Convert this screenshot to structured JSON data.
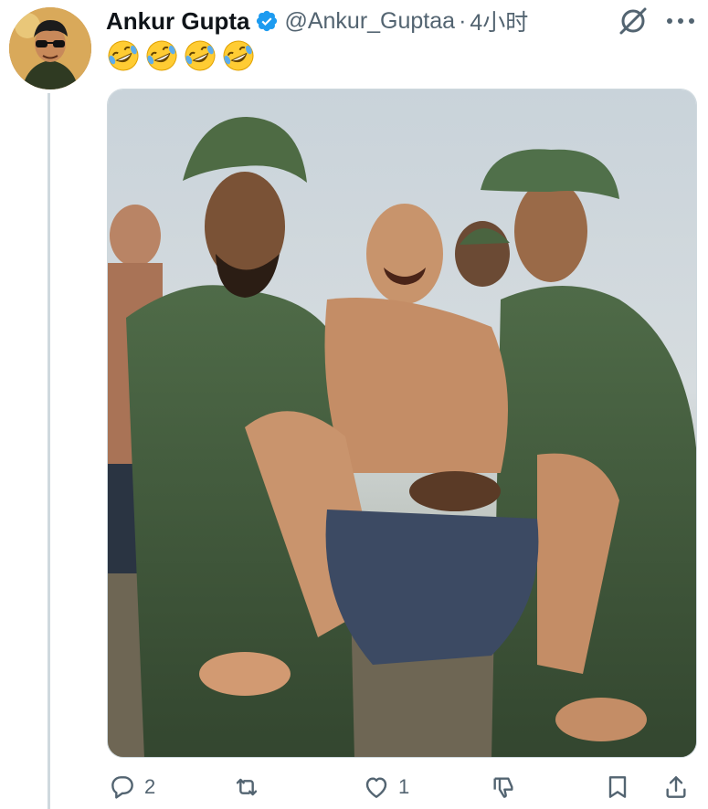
{
  "tweet": {
    "author": {
      "display_name": "Ankur Gupta",
      "handle": "@Ankur_Guptaa",
      "verified": true,
      "avatar_icon": "avatar-cartoon-man-sunglasses"
    },
    "separator": "·",
    "timestamp": "4小时",
    "emojis": [
      "rolling-on-floor-laughing-emoji",
      "rolling-on-floor-laughing-emoji",
      "rolling-on-floor-laughing-emoji",
      "rolling-on-floor-laughing-emoji"
    ],
    "media": {
      "type": "photo",
      "icon": "colorized-photo-soldiers-carrying-man"
    },
    "actions": {
      "reply": {
        "icon": "reply-icon",
        "count": "2"
      },
      "retweet": {
        "icon": "retweet-icon",
        "count": ""
      },
      "like": {
        "icon": "heart-icon",
        "count": "1"
      },
      "dislike": {
        "icon": "dislike-icon"
      },
      "bookmark": {
        "icon": "bookmark-icon"
      },
      "share": {
        "icon": "share-icon"
      }
    }
  },
  "colors": {
    "text_primary": "#0f1419",
    "text_secondary": "#536471",
    "verified_blue": "#1d9bf0",
    "thread_line": "#cfd9de"
  }
}
